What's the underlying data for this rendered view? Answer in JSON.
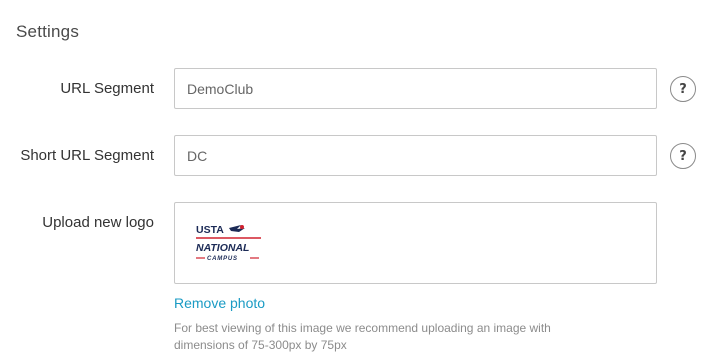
{
  "section": {
    "title": "Settings"
  },
  "url_segment": {
    "label": "URL Segment",
    "value": "DemoClub",
    "help": "?"
  },
  "short_url_segment": {
    "label": "Short URL Segment",
    "value": "DC",
    "help": "?"
  },
  "logo": {
    "label": "Upload new logo",
    "brand_top": "USTA",
    "brand_middle": "NATIONAL",
    "brand_bottom": "CAMPUS",
    "remove_label": "Remove photo",
    "hint": "For best viewing of this image we recommend uploading an image with dimensions of 75-300px by 75px"
  },
  "colors": {
    "link": "#1a9bc4",
    "logo_navy": "#1b2a56",
    "logo_red": "#d0202e"
  }
}
